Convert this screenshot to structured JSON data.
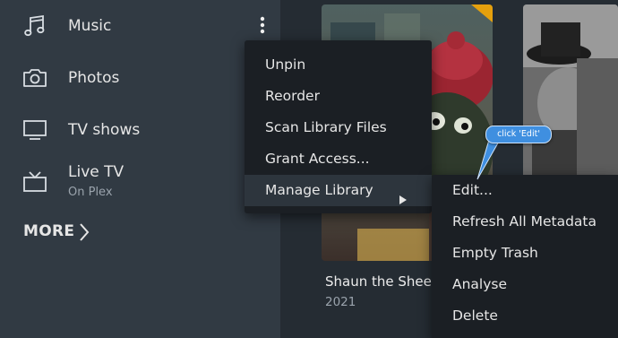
{
  "sidebar": {
    "items": [
      {
        "label": "Music",
        "icon": "music-note-icon"
      },
      {
        "label": "Photos",
        "icon": "camera-icon"
      },
      {
        "label": "TV shows",
        "icon": "monitor-icon"
      },
      {
        "label": "Live TV",
        "sublabel": "On Plex",
        "icon": "tv-antenna-icon"
      }
    ],
    "more_label": "MORE"
  },
  "context_menu": {
    "items": [
      "Unpin",
      "Reorder",
      "Scan Library Files",
      "Grant Access...",
      "Manage Library"
    ]
  },
  "submenu": {
    "items": [
      "Edit...",
      "Refresh All Metadata",
      "Empty Trash",
      "Analyse",
      "Delete"
    ]
  },
  "main": {
    "poster_title": "Shaun the Sheep",
    "poster_year": "2021"
  },
  "annotation": {
    "callout_text": "click 'Edit'"
  },
  "colors": {
    "sidebar_bg": "#313a43",
    "main_bg": "#252c33",
    "menu_bg": "#1b1f24",
    "callout_blue": "#3f8fe0",
    "poster_badge": "#e5a00d"
  }
}
